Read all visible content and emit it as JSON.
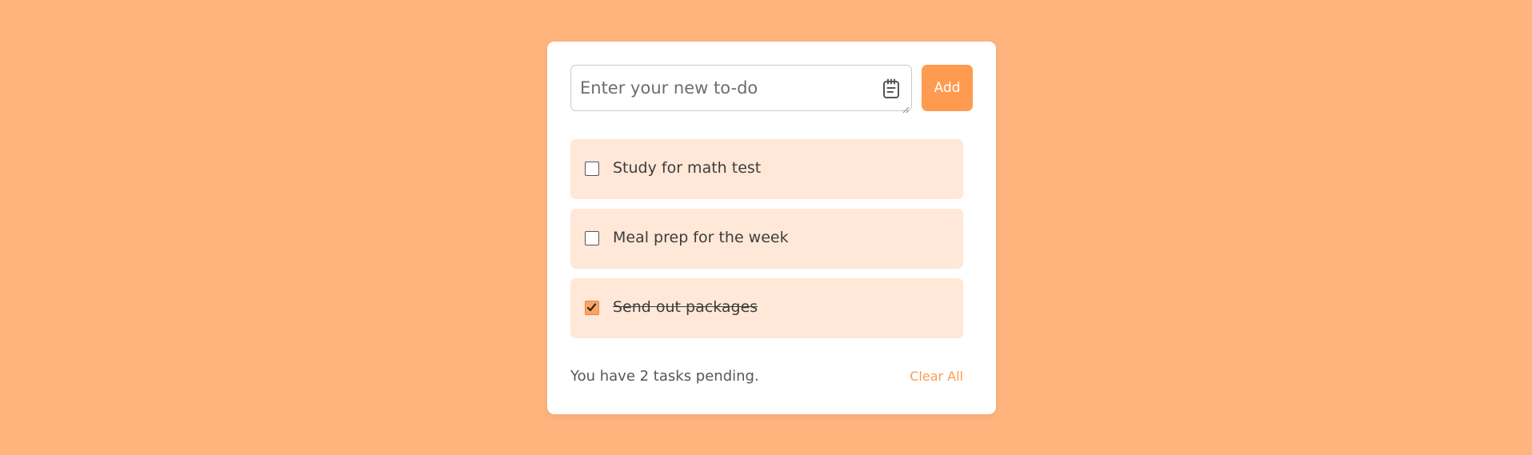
{
  "colors": {
    "background": "#ffb47e",
    "accent": "#ff9b50",
    "task_background": "#ffe8d7",
    "card": "#ffffff"
  },
  "input": {
    "value": "",
    "placeholder": "Enter your new to-do",
    "icon": "notepad-icon"
  },
  "add_button": {
    "label": "Add"
  },
  "tasks": [
    {
      "label": "Study for math test",
      "checked": false
    },
    {
      "label": "Meal prep for the week",
      "checked": false
    },
    {
      "label": "Send out packages",
      "checked": true
    }
  ],
  "footer": {
    "pending_text": "You have 2 tasks pending.",
    "clear_label": "Clear All"
  }
}
